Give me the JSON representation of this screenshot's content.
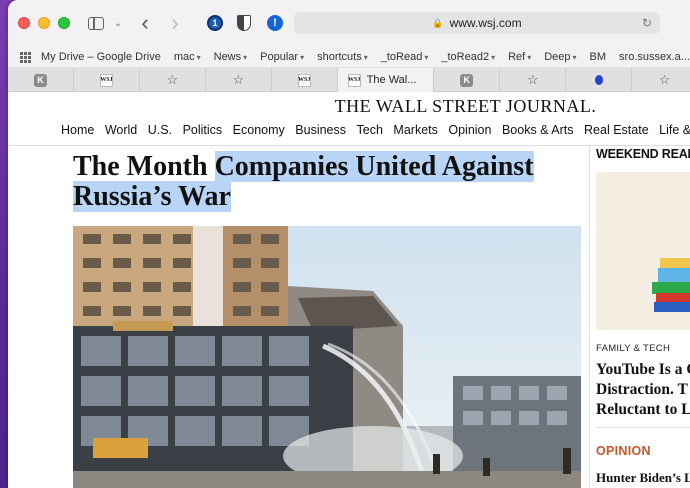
{
  "browser": {
    "url": "www.wsj.com"
  },
  "bookmarks": [
    {
      "label": "My Drive – Google Drive",
      "dropdown": false
    },
    {
      "label": "mac",
      "dropdown": true
    },
    {
      "label": "News",
      "dropdown": true
    },
    {
      "label": "Popular",
      "dropdown": true
    },
    {
      "label": "shortcuts",
      "dropdown": true
    },
    {
      "label": "_toRead",
      "dropdown": true
    },
    {
      "label": "_toRead2",
      "dropdown": true
    },
    {
      "label": "Ref",
      "dropdown": true
    },
    {
      "label": "Deep",
      "dropdown": true
    },
    {
      "label": "BM",
      "dropdown": false
    },
    {
      "label": "sro.sussex.a....nas_pa",
      "dropdown": false
    }
  ],
  "tabs": [
    {
      "favicon": "K"
    },
    {
      "favicon": "WSJ"
    },
    {
      "favicon": "star"
    },
    {
      "favicon": "star"
    },
    {
      "favicon": "WSJ"
    },
    {
      "favicon": "WSJ",
      "label": "The Wal...",
      "active": true
    },
    {
      "favicon": "K"
    },
    {
      "favicon": "star"
    },
    {
      "favicon": "blue"
    },
    {
      "favicon": "star"
    }
  ],
  "page": {
    "masthead": "THE WALL STREET JOURNAL.",
    "nav": [
      "Home",
      "World",
      "U.S.",
      "Politics",
      "Economy",
      "Business",
      "Tech",
      "Markets",
      "Opinion",
      "Books & Arts",
      "Real Estate",
      "Life & Work"
    ],
    "headline_plain": "The Month ",
    "headline_highlight_1": "Companies United Against",
    "headline_highlight_2": "Russia’s War",
    "rail": {
      "title": "WEEKEND READ",
      "kicker": "FAMILY & TECH",
      "story": "YouTube Is a C\nDistraction. T\nReluctant to L",
      "section": "OPINION",
      "opinion_story": "Hunter Biden’s L"
    }
  },
  "colors": {
    "highlight": "#b8d5f7",
    "opinion": "#c0592a"
  }
}
